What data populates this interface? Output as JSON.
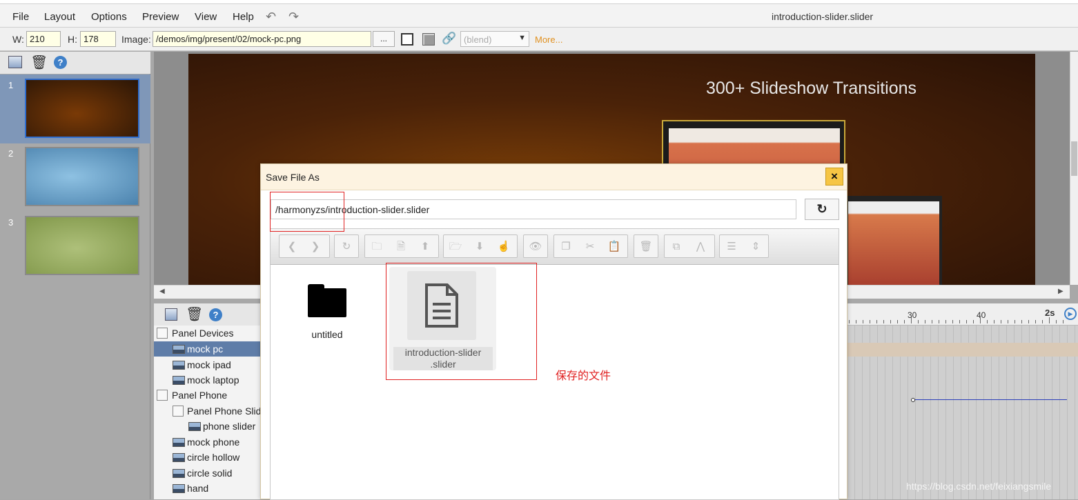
{
  "window": {
    "document_title": "introduction-slider.slider"
  },
  "menu": [
    "File",
    "Layout",
    "Options",
    "Preview",
    "View",
    "Help"
  ],
  "propbar": {
    "w_label": "W:",
    "w_value": "210",
    "h_label": "H:",
    "h_value": "178",
    "image_label": "Image:",
    "image_value": "/demos/img/present/02/mock-pc.png",
    "browse_label": "...",
    "blend_placeholder": "(blend)",
    "more_label": "More..."
  },
  "slides": [
    {
      "num": "1",
      "color_a": "#6b3206",
      "color_b": "#2a1506"
    },
    {
      "num": "2",
      "color_a": "#7fb0d5",
      "color_b": "#4c86b0"
    },
    {
      "num": "3",
      "color_a": "#a3b770",
      "color_b": "#7d9446"
    }
  ],
  "canvas": {
    "heading": "300+ Slideshow Transitions"
  },
  "layers": [
    {
      "label": "Panel Devices",
      "kind": "panel",
      "indent": 0
    },
    {
      "label": "mock pc",
      "kind": "image",
      "indent": 1,
      "selected": true
    },
    {
      "label": "mock ipad",
      "kind": "image",
      "indent": 1
    },
    {
      "label": "mock laptop",
      "kind": "image",
      "indent": 1
    },
    {
      "label": "Panel Phone",
      "kind": "panel",
      "indent": 0
    },
    {
      "label": "Panel Phone Slider",
      "kind": "panel",
      "indent": 1
    },
    {
      "label": "phone slider",
      "kind": "image",
      "indent": 2
    },
    {
      "label": "mock phone",
      "kind": "image",
      "indent": 1
    },
    {
      "label": "circle hollow",
      "kind": "image",
      "indent": 1
    },
    {
      "label": "circle solid",
      "kind": "image",
      "indent": 1
    },
    {
      "label": "hand",
      "kind": "image",
      "indent": 1
    }
  ],
  "timeline": {
    "labels": [
      "30",
      "40",
      "2s"
    ]
  },
  "dialog": {
    "title": "Save File As",
    "close_label": "×",
    "path": "/harmonyzs/introduction-slider.slider",
    "refresh_icon": "↻",
    "files": [
      {
        "name": "untitled",
        "type": "folder"
      },
      {
        "name": "introduction-slider .slider",
        "type": "file"
      }
    ]
  },
  "annotation": {
    "text": "保存的文件",
    "color": "#e02020"
  },
  "watermark": "https://blog.csdn.net/feixiangsmile",
  "colors": {
    "accent": "#f6c544",
    "selection": "#5f7da8",
    "annotation": "#e02020"
  }
}
